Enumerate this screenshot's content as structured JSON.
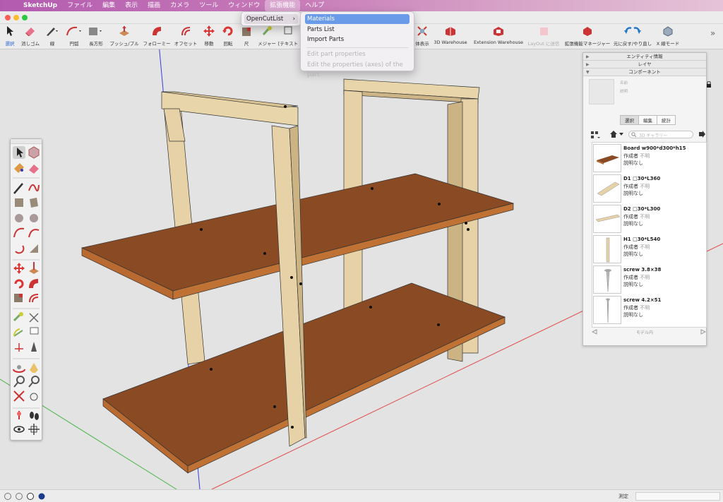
{
  "menubar": {
    "apple": "",
    "app": "SketchUp",
    "items": [
      "ファイル",
      "編集",
      "表示",
      "描画",
      "カメラ",
      "ツール",
      "ウィンドウ",
      "拡張機能",
      "ヘルプ"
    ],
    "active": "拡張機能"
  },
  "toolbar": {
    "tools": [
      {
        "label": "選択",
        "icon": "select-arrow-icon"
      },
      {
        "label": "消しゴム",
        "icon": "eraser-icon"
      },
      {
        "label": "線",
        "icon": "pencil-icon"
      },
      {
        "label": "円弧",
        "icon": "arc-icon"
      },
      {
        "label": "長方形",
        "icon": "rectangle-icon"
      },
      {
        "label": "プッシュ/プル",
        "icon": "push-pull-icon"
      },
      {
        "label": "フォローミー",
        "icon": "follow-me-icon"
      },
      {
        "label": "オフセット",
        "icon": "offset-icon"
      },
      {
        "label": "移動",
        "icon": "move-icon"
      },
      {
        "label": "回転",
        "icon": "rotate-icon"
      },
      {
        "label": "尺",
        "icon": "scale-icon"
      },
      {
        "label": "メジャー",
        "icon": "tape-measure-icon"
      },
      {
        "label": "[テキスト",
        "icon": "text-icon"
      }
    ],
    "right_tools": [
      {
        "label": "体表示",
        "icon": "view-icon"
      },
      {
        "label": "3D Warehouse",
        "icon": "3d-warehouse-icon"
      },
      {
        "label": "Extension Warehouse",
        "icon": "extension-warehouse-icon"
      },
      {
        "label": "LayOut に送信",
        "icon": "layout-icon"
      },
      {
        "label": "拡張機能マネージャー",
        "icon": "extension-manager-icon"
      },
      {
        "label": "元に戻す/やり直し",
        "icon": "undo-redo-icon"
      },
      {
        "label": "X 線モード",
        "icon": "xray-icon"
      }
    ],
    "overflow": "»"
  },
  "extensions_menu": {
    "item": "OpenCutList",
    "arrow": "›"
  },
  "opencutlist_menu": {
    "items": [
      "Materials",
      "Parts List",
      "Import Parts"
    ],
    "disabled": [
      "Edit part properties",
      "Edit the properties (axes) of the part"
    ],
    "selected": "Materials"
  },
  "panel": {
    "sections": [
      "エンティティ情報",
      "レイヤ",
      "コンポーネント"
    ],
    "preview": {
      "name_label": "名前",
      "desc_label": "説明"
    },
    "tabs": [
      "選択",
      "編集",
      "統計"
    ],
    "active_tab": "選択",
    "search_placeholder": "3D ギャラリー",
    "components": [
      {
        "name": "Board w900*d300*h15",
        "author_label": "作成者",
        "author": "不明",
        "desc": "説明なし"
      },
      {
        "name": "D1 □30*L360",
        "author_label": "作成者",
        "author": "不明",
        "desc": "説明なし"
      },
      {
        "name": "D2 □30*L300",
        "author_label": "作成者",
        "author": "不明",
        "desc": "説明なし"
      },
      {
        "name": "H1 □30*L540",
        "author_label": "作成者",
        "author": "不明",
        "desc": "説明なし"
      },
      {
        "name": "screw 3.8×38",
        "author_label": "作成者",
        "author": "不明",
        "desc": "説明なし"
      },
      {
        "name": "screw 4.2×51",
        "author_label": "作成者",
        "author": "不明",
        "desc": "説明なし"
      }
    ],
    "footer": "モデル内"
  },
  "status": {
    "measure_label": "測定"
  },
  "colors": {
    "wood_top": "#8a4a24",
    "wood_edge": "#b86a30",
    "post": "#e6d2a6",
    "post_dark": "#cbb384",
    "menu_highlight": "#6a9be8"
  }
}
